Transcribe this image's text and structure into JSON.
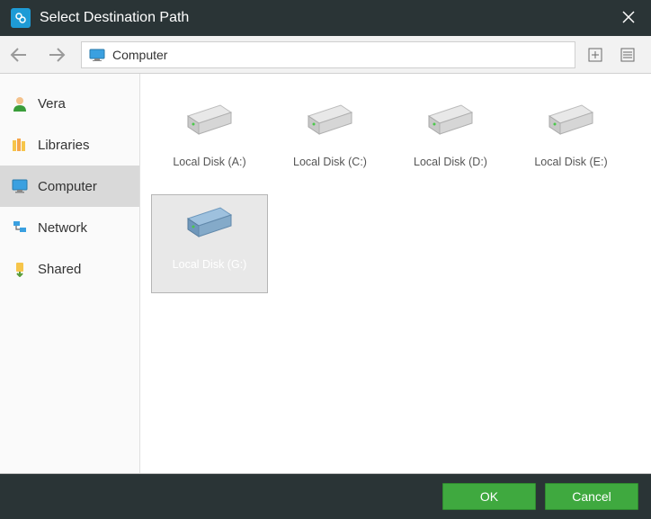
{
  "title": "Select Destination Path",
  "breadcrumb": {
    "label": "Computer"
  },
  "sidebar": {
    "items": [
      {
        "label": "Vera",
        "icon": "user-icon",
        "selected": false
      },
      {
        "label": "Libraries",
        "icon": "library-icon",
        "selected": false
      },
      {
        "label": "Computer",
        "icon": "monitor-icon",
        "selected": true
      },
      {
        "label": "Network",
        "icon": "network-icon",
        "selected": false
      },
      {
        "label": "Shared",
        "icon": "shared-icon",
        "selected": false
      }
    ]
  },
  "drives": [
    {
      "label": "Local Disk (A:)",
      "selected": false,
      "color": "gray"
    },
    {
      "label": "Local Disk (C:)",
      "selected": false,
      "color": "gray"
    },
    {
      "label": "Local Disk (D:)",
      "selected": false,
      "color": "gray"
    },
    {
      "label": "Local Disk (E:)",
      "selected": false,
      "color": "gray"
    },
    {
      "label": "Local Disk (G:)",
      "selected": true,
      "color": "blue"
    }
  ],
  "buttons": {
    "ok": "OK",
    "cancel": "Cancel"
  }
}
